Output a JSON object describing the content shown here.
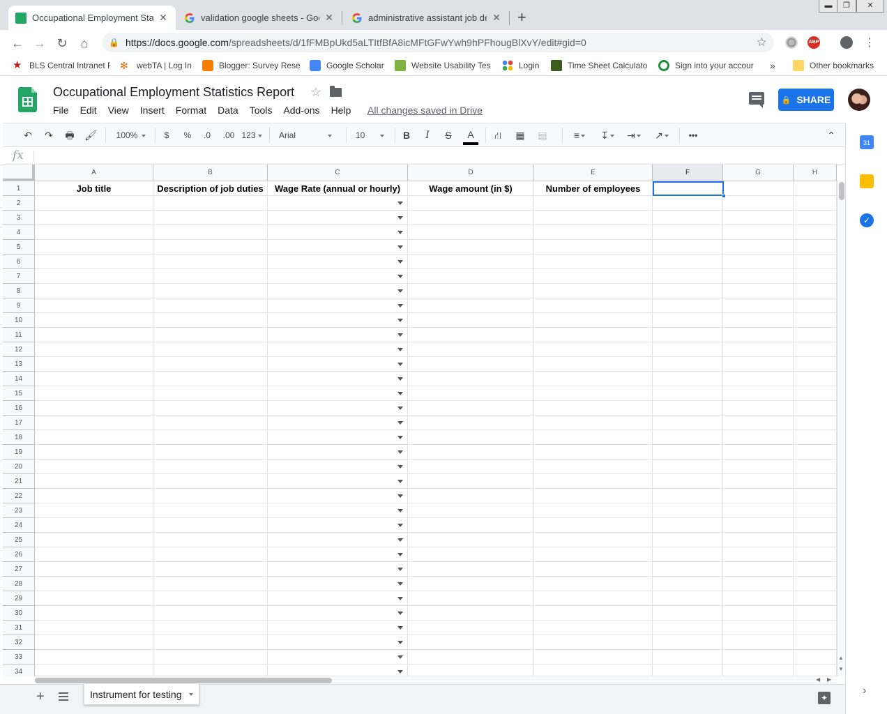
{
  "browser": {
    "tabs": [
      {
        "title": "Occupational Employment Statis",
        "close": "✕"
      },
      {
        "title": "validation google sheets - Googl",
        "close": "✕"
      },
      {
        "title": "administrative assistant job desc",
        "close": "✕"
      }
    ],
    "new_tab": "+",
    "url_host": "https://docs.google.com",
    "url_path": "/spreadsheets/d/1fFMBpUkd5aLTItfBfA8icMFtGFwYwh9hPFhougBlXvY/edit#gid=0",
    "bookmarks": [
      "BLS Central Intranet F",
      "webTA | Log In",
      "Blogger: Survey Rese",
      "Google Scholar",
      "Website Usability Tes",
      "Login",
      "Time Sheet Calculato",
      "Sign into your accour"
    ],
    "bookmarks_overflow": "»",
    "other_bookmarks": "Other bookmarks",
    "ext_abp": "ABP"
  },
  "doc": {
    "title": "Occupational Employment Statistics Report",
    "menu": [
      "File",
      "Edit",
      "View",
      "Insert",
      "Format",
      "Data",
      "Tools",
      "Add-ons",
      "Help"
    ],
    "saved_status": "All changes saved in Drive",
    "share_label": "SHARE"
  },
  "toolbar": {
    "zoom": "100%",
    "currency": "$",
    "percent": "%",
    "decrease_decimals": ".0",
    "increase_decimals": ".00",
    "more_formats": "123",
    "font": "Arial",
    "font_size": "10",
    "bold": "B",
    "italic": "I",
    "strike": "S",
    "text_color": "A",
    "more": "•••"
  },
  "formula_bar": {
    "fx": "fx",
    "value": ""
  },
  "sheet": {
    "columns": [
      "A",
      "B",
      "C",
      "D",
      "E",
      "F",
      "G",
      "H"
    ],
    "headers": [
      "Job title",
      "Description of job duties",
      "Wage Rate (annual or hourly)",
      "Wage amount (in $)",
      "Number of employees",
      "",
      "",
      ""
    ],
    "rows": [
      "1",
      "2",
      "3",
      "4",
      "5",
      "6",
      "7",
      "8",
      "9",
      "10",
      "11",
      "12",
      "13",
      "14",
      "15",
      "16",
      "17",
      "18",
      "19",
      "20",
      "21",
      "22",
      "23",
      "24",
      "25",
      "26",
      "27",
      "28",
      "29",
      "30",
      "31",
      "32",
      "33",
      "34"
    ],
    "selected_cell": "F1",
    "tab_name": "Instrument for testing"
  },
  "colors": {
    "accent": "#1a73e8",
    "sheets_green": "#23a566",
    "tab_bar": "#dee1e6"
  }
}
